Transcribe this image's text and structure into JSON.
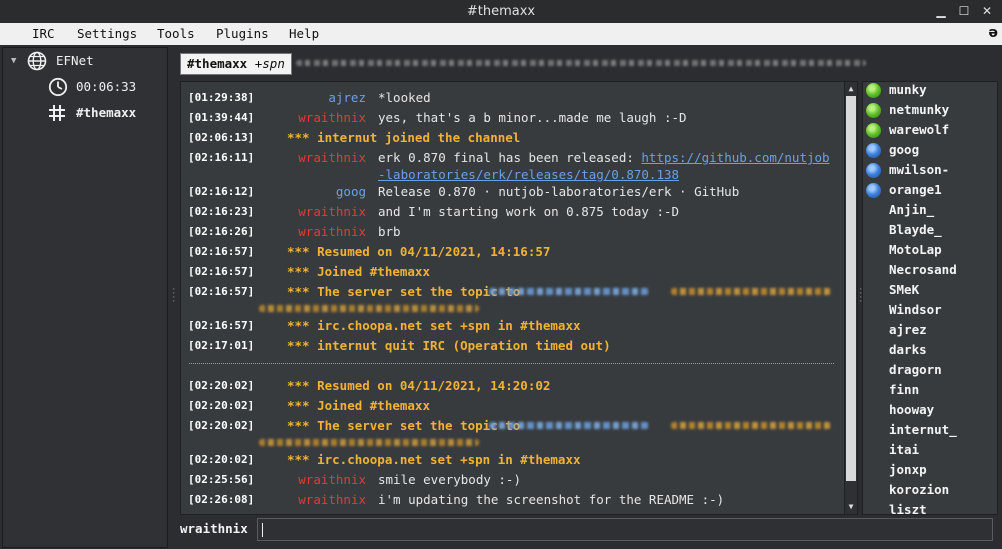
{
  "window": {
    "title": "#themaxx"
  },
  "menubar": {
    "items": [
      "IRC",
      "Settings",
      "Tools",
      "Plugins",
      "Help"
    ]
  },
  "sidebar": {
    "network": "EFNet",
    "uptime": "00:06:33",
    "channel": "#themaxx"
  },
  "topicbar": {
    "channel": "#themaxx",
    "modes": "+spn"
  },
  "colors": {
    "system": "#f2b233",
    "nick_red": "#e23a3a",
    "nick_blue": "#6aa0e8",
    "link": "#6aa0e8"
  },
  "messages": [
    {
      "time": "[01:29:38]",
      "nick": "ajrez",
      "nick_color": "#6aa0e8",
      "text": "*looked"
    },
    {
      "time": "[01:39:44]",
      "nick": "wraithnix",
      "nick_color": "#e23a3a",
      "text": "yes, that's a b minor...made me laugh :-D"
    },
    {
      "time": "[02:06:13]",
      "system": "*** internut joined the channel"
    },
    {
      "time": "[02:16:11]",
      "nick": "wraithnix",
      "nick_color": "#e23a3a",
      "text": "erk 0.870 final has been released: ",
      "link": "https://github.com/nutjob-laboratories/erk/releases/tag/0.870.138"
    },
    {
      "time": "[02:16:12]",
      "nick": "goog",
      "nick_color": "#6aa0e8",
      "text": "Release 0.870 · nutjob-laboratories/erk · GitHub"
    },
    {
      "time": "[02:16:23]",
      "nick": "wraithnix",
      "nick_color": "#e23a3a",
      "text": "and I'm starting work on 0.875 today :-D"
    },
    {
      "time": "[02:16:26]",
      "nick": "wraithnix",
      "nick_color": "#e23a3a",
      "text": "brb"
    },
    {
      "time": "[02:16:57]",
      "system": "*** Resumed on 04/11/2021, 14:16:57"
    },
    {
      "time": "[02:16:57]",
      "system": "*** Joined #themaxx"
    },
    {
      "time": "[02:16:57]",
      "system": "*** The server set the topic to"
    },
    {
      "time": "[02:16:57]",
      "system": "*** irc.choopa.net set +spn in #themaxx"
    },
    {
      "time": "[02:17:01]",
      "system": "*** internut quit IRC (Operation timed out)"
    },
    {
      "time": "[02:20:02]",
      "system": "*** Resumed on 04/11/2021, 14:20:02"
    },
    {
      "time": "[02:20:02]",
      "system": "*** Joined #themaxx"
    },
    {
      "time": "[02:20:02]",
      "system": "*** The server set the topic to"
    },
    {
      "time": "[02:20:02]",
      "system": "*** irc.choopa.net set +spn in #themaxx"
    },
    {
      "time": "[02:25:56]",
      "nick": "wraithnix",
      "nick_color": "#e23a3a",
      "text": "smile everybody :-)"
    },
    {
      "time": "[02:26:08]",
      "nick": "wraithnix",
      "nick_color": "#e23a3a",
      "text": "i'm updating the screenshot for the README :-)"
    }
  ],
  "nicklist": [
    {
      "nick": "munky",
      "status": "op"
    },
    {
      "nick": "netmunky",
      "status": "op"
    },
    {
      "nick": "warewolf",
      "status": "op"
    },
    {
      "nick": "goog",
      "status": "voice"
    },
    {
      "nick": "mwilson-",
      "status": "voice"
    },
    {
      "nick": "orange1",
      "status": "voice"
    },
    {
      "nick": "Anjin_",
      "status": ""
    },
    {
      "nick": "Blayde_",
      "status": ""
    },
    {
      "nick": "MotoLap",
      "status": ""
    },
    {
      "nick": "Necrosand",
      "status": ""
    },
    {
      "nick": "SMeK",
      "status": ""
    },
    {
      "nick": "Windsor",
      "status": ""
    },
    {
      "nick": "ajrez",
      "status": ""
    },
    {
      "nick": "darks",
      "status": ""
    },
    {
      "nick": "dragorn",
      "status": ""
    },
    {
      "nick": "finn",
      "status": ""
    },
    {
      "nick": "hooway",
      "status": ""
    },
    {
      "nick": "internut_",
      "status": ""
    },
    {
      "nick": "itai",
      "status": ""
    },
    {
      "nick": "jonxp",
      "status": ""
    },
    {
      "nick": "korozion",
      "status": ""
    },
    {
      "nick": "liszt",
      "status": ""
    }
  ],
  "input": {
    "nick": "wraithnix",
    "value": ""
  }
}
